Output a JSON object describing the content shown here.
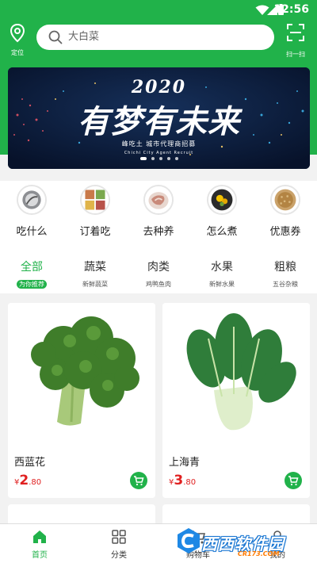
{
  "status_bar": {
    "time": "12:56"
  },
  "header": {
    "location_label": "定位",
    "search_placeholder": "大白菜",
    "scan_label": "扫一扫"
  },
  "banner": {
    "year": "2020",
    "title": "有梦有未来",
    "subtitle": "峰吃土 城市代理商招募",
    "subtitle_en": "Chichi City Agent Recruit",
    "slide_count": 5,
    "active_slide": 1
  },
  "quick_menu": [
    {
      "label": "吃什么",
      "icon": "bowl-icon"
    },
    {
      "label": "订着吃",
      "icon": "meal-plate-icon"
    },
    {
      "label": "去种养",
      "icon": "meat-plate-icon"
    },
    {
      "label": "怎么煮",
      "icon": "cooked-dish-icon"
    },
    {
      "label": "优惠券",
      "icon": "grain-bowl-icon"
    }
  ],
  "categories": [
    {
      "name": "全部",
      "desc": "为你推荐",
      "active": true
    },
    {
      "name": "蔬菜",
      "desc": "新鲜蔬菜",
      "active": false
    },
    {
      "name": "肉类",
      "desc": "鸡鸭鱼肉",
      "active": false
    },
    {
      "name": "水果",
      "desc": "新鲜水果",
      "active": false
    },
    {
      "name": "粗粮",
      "desc": "五谷杂粮",
      "active": false
    }
  ],
  "products": [
    {
      "name": "西蓝花",
      "currency": "¥",
      "price_int": "2",
      "price_dec": ".80",
      "image": "broccoli"
    },
    {
      "name": "上海青",
      "currency": "¥",
      "price_int": "3",
      "price_dec": ".80",
      "image": "bok-choy"
    }
  ],
  "bottom_nav": [
    {
      "label": "首页",
      "icon": "home-icon",
      "active": true
    },
    {
      "label": "分类",
      "icon": "grid-icon",
      "active": false
    },
    {
      "label": "购物车",
      "icon": "cart-icon",
      "active": false
    },
    {
      "label": "我的",
      "icon": "user-icon",
      "active": false
    }
  ],
  "watermark": {
    "text": "西西软件园",
    "url": "CR173.COM"
  },
  "colors": {
    "brand": "#21b24a",
    "price": "#e02020",
    "banner_bg": "#0b1a33"
  }
}
